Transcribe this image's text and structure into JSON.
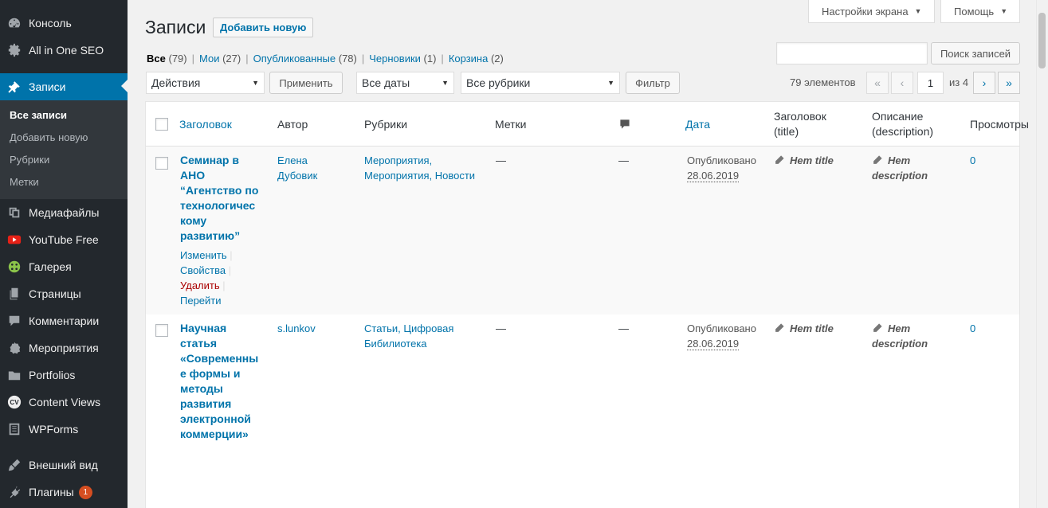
{
  "sidebar": {
    "items": [
      {
        "label": "Консоль",
        "icon": "dashboard-icon"
      },
      {
        "label": "All in One SEO",
        "icon": "gear-icon"
      },
      {
        "label": "Записи",
        "icon": "pin-icon"
      },
      {
        "label": "Медиафайлы",
        "icon": "media-icon"
      },
      {
        "label": "YouTube Free",
        "icon": "youtube-icon"
      },
      {
        "label": "Галерея",
        "icon": "gallery-icon"
      },
      {
        "label": "Страницы",
        "icon": "pages-icon"
      },
      {
        "label": "Комментарии",
        "icon": "comments-icon"
      },
      {
        "label": "Мероприятия",
        "icon": "events-icon"
      },
      {
        "label": "Portfolios",
        "icon": "portfolio-icon"
      },
      {
        "label": "Content Views",
        "icon": "cv-icon"
      },
      {
        "label": "WPForms",
        "icon": "forms-icon"
      },
      {
        "label": "Внешний вид",
        "icon": "brush-icon"
      },
      {
        "label": "Плагины",
        "icon": "plugin-icon",
        "badge": "1"
      }
    ],
    "submenu": [
      "Все записи",
      "Добавить новую",
      "Рубрики",
      "Метки"
    ]
  },
  "top": {
    "screen_options": "Настройки экрана",
    "help": "Помощь"
  },
  "heading": {
    "title": "Записи",
    "add_new": "Добавить новую"
  },
  "views": [
    {
      "label": "Все",
      "count": "(79)"
    },
    {
      "label": "Мои",
      "count": "(27)"
    },
    {
      "label": "Опубликованные",
      "count": "(78)"
    },
    {
      "label": "Черновики",
      "count": "(1)"
    },
    {
      "label": "Корзина",
      "count": "(2)"
    }
  ],
  "search": {
    "placeholder": "",
    "button": "Поиск записей"
  },
  "tablenav": {
    "bulk_action": "Действия",
    "apply": "Применить",
    "dates": "Все даты",
    "categories": "Все рубрики",
    "filter": "Фильтр",
    "items_count": "79 элементов",
    "first": "«",
    "prev": "‹",
    "current_page": "1",
    "of_pages": "из 4",
    "next": "›",
    "last": "»"
  },
  "columns": {
    "title": "Заголовок",
    "author": "Автор",
    "categories": "Рубрики",
    "tags": "Метки",
    "date": "Дата",
    "seo_title": "Заголовок (title)",
    "seo_desc": "Описание (description)",
    "views": "Просмотры"
  },
  "rows": [
    {
      "title": "Семинар в АНО “Агентство по технологическому развитию”",
      "author": "Елена Дубовик",
      "categories": "Мероприятия, Мероприятия, Новости",
      "tags": "—",
      "comments": "—",
      "status": "Опубликовано",
      "date": "28.06.2019",
      "seo_title": "Нет title",
      "seo_desc": "Нет description",
      "views": "0",
      "actions": {
        "edit": "Изменить",
        "props": "Свойства",
        "delete": "Удалить",
        "view": "Перейти"
      }
    },
    {
      "title": "Научная статья «Современные формы и методы развития электронной коммерции»",
      "author": "s.lunkov",
      "categories": "Статьи, Цифровая Бибилиотека",
      "tags": "—",
      "comments": "—",
      "status": "Опубликовано",
      "date": "28.06.2019",
      "seo_title": "Нет title",
      "seo_desc": "Нет description",
      "views": "0"
    }
  ]
}
